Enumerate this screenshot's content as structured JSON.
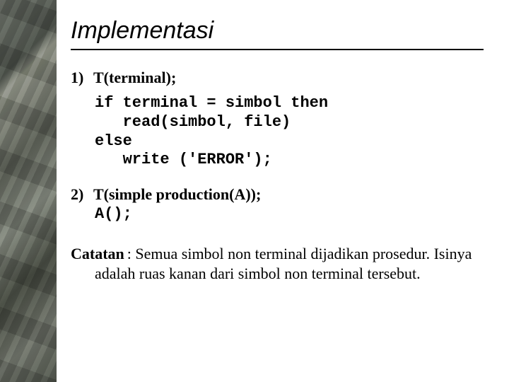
{
  "title": "Implementasi",
  "items": [
    {
      "num": "1)",
      "signature": "T(terminal);",
      "code": "if terminal = simbol then\n   read(simbol, file)\nelse\n   write ('ERROR');"
    },
    {
      "num": "2)",
      "signature": "T(simple production(A));",
      "call": "A();"
    }
  ],
  "note": {
    "label": "Catatan",
    "text": ": Semua simbol non terminal dijadikan prosedur. Isinya adalah ruas kanan dari simbol non terminal tersebut."
  }
}
